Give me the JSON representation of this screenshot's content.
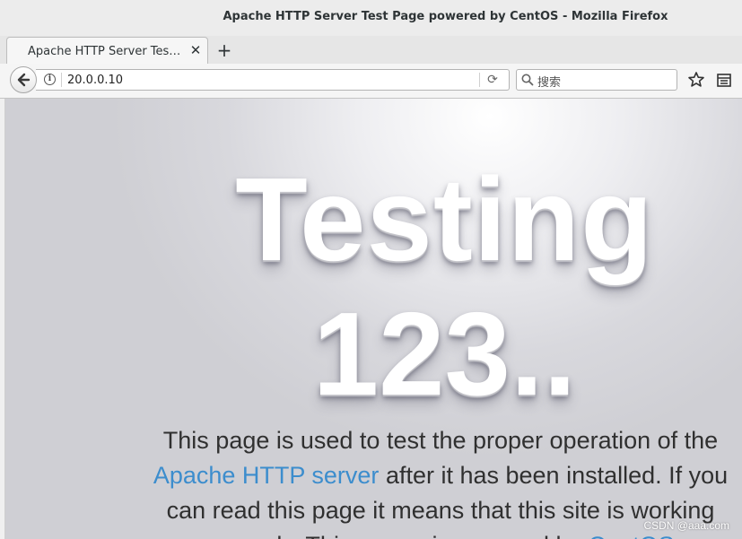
{
  "window": {
    "title": "Apache HTTP Server Test Page powered by CentOS - Mozilla Firefox"
  },
  "tabs": [
    {
      "title": "Apache HTTP Server Tes…",
      "close_glyph": "✕",
      "active": true
    }
  ],
  "new_tab_glyph": "+",
  "navbar": {
    "url": "20.0.0.10",
    "search_placeholder": "搜索",
    "icons": [
      "back-arrow-icon",
      "info-icon",
      "reload-icon",
      "search-icon",
      "star-icon",
      "library-icon"
    ]
  },
  "page": {
    "hero_line1": "Testing",
    "hero_line2": "123..",
    "para_part1": "This page is used to test the proper operation of the",
    "link_apache": "Apache HTTP server",
    "para_part2": "after it has been installed. If you can read this page it means that this site is working",
    "para_part3": "properly. This server is powered by",
    "link_centos": "CentOS",
    "link_color": "#3c8dcd"
  },
  "watermark": "CSDN @aaa.com"
}
